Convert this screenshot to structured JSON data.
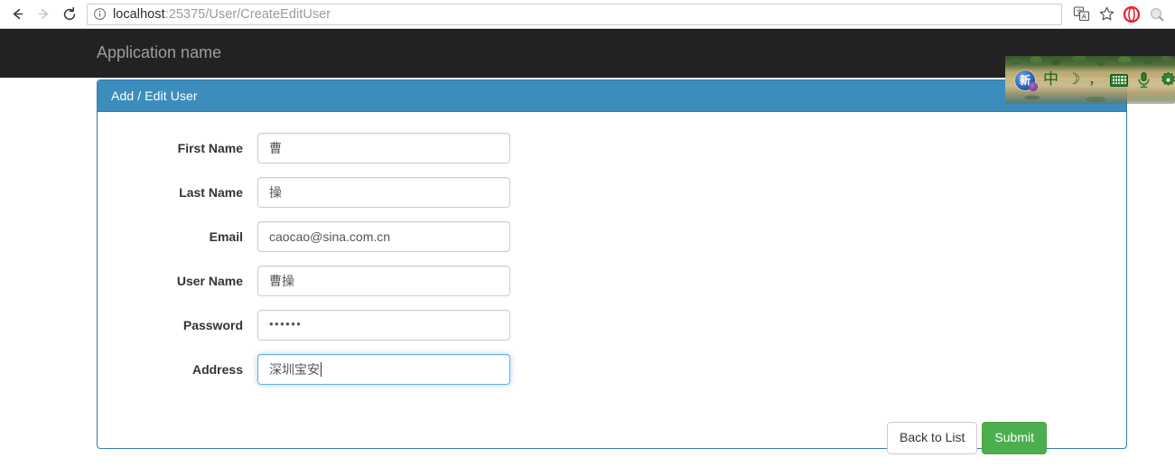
{
  "browser": {
    "back_icon": "arrow-left-icon",
    "forward_icon": "arrow-right-icon",
    "reload_icon": "reload-icon",
    "info_icon": "info-circle-icon",
    "url_host": "localhost",
    "url_path": ":25375/User/CreateEditUser",
    "url_full": "localhost:25375/User/CreateEditUser",
    "translate_icon": "translate-icon",
    "bookmark_icon": "star-icon",
    "opera_icon": "opera-logo-icon",
    "search_icon": "search-icon"
  },
  "navbar": {
    "brand": "Application name",
    "background": "#222222"
  },
  "panel": {
    "title": "Add / Edit User",
    "header_background": "#3c8dbc",
    "border_color": "#337ab7"
  },
  "form": {
    "fields": [
      {
        "label": "First Name",
        "value": "曹",
        "type": "text",
        "focused": false
      },
      {
        "label": "Last Name",
        "value": "操",
        "type": "text",
        "focused": false
      },
      {
        "label": "Email",
        "value": "caocao@sina.com.cn",
        "type": "text",
        "focused": false
      },
      {
        "label": "User Name",
        "value": "曹操",
        "type": "text",
        "focused": false
      },
      {
        "label": "Password",
        "value": "••••••",
        "type": "password",
        "focused": false
      },
      {
        "label": "Address",
        "value": "深圳宝安",
        "type": "text",
        "focused": true
      }
    ]
  },
  "actions": {
    "back_label": "Back to List",
    "submit_label": "Submit",
    "submit_color": "#4cae4c"
  },
  "ime_toolbar": {
    "logo": "新",
    "mode_glyph": "中",
    "shape_glyph": "☽",
    "punctuation_glyph": "，",
    "keyboard_icon": "keyboard-icon",
    "microphone_icon": "microphone-icon",
    "settings_icon": "gear-icon"
  }
}
